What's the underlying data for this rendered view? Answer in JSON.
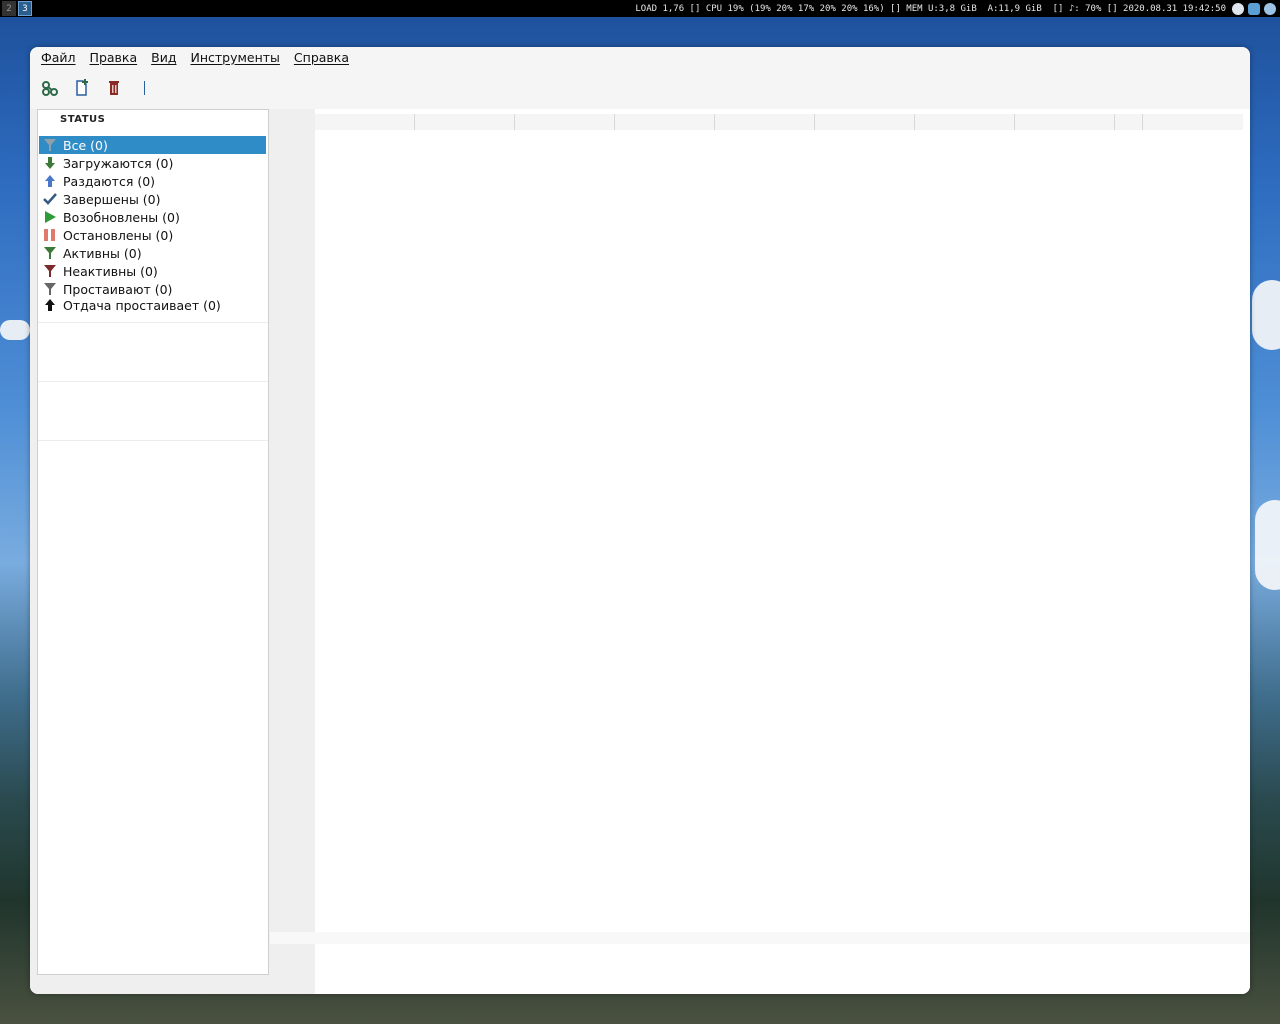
{
  "panel": {
    "workspaces": [
      "2",
      "3"
    ],
    "status": "LOAD 1,76 [] CPU 19% (19% 20% 17% 20% 20% 16%) [] MEM U:3,8 GiB  A:11,9 GiB  [] ♪: 70% [] 2020.08.31 19:42:50"
  },
  "menu": {
    "file": "Файл",
    "edit": "Правка",
    "view": "Вид",
    "tools": "Инструменты",
    "help": "Справка"
  },
  "toolbar": {
    "icons": [
      "add-torrent-link-icon",
      "add-torrent-file-icon",
      "delete-icon"
    ]
  },
  "sidebar": {
    "header": "STATUS",
    "filters": [
      {
        "label": "Все (0)",
        "icon": "filter-icon"
      },
      {
        "label": "Загружаются (0)",
        "icon": "arrow-down-icon"
      },
      {
        "label": "Раздаются (0)",
        "icon": "arrow-up-icon"
      },
      {
        "label": "Завершены (0)",
        "icon": "checkmark-icon"
      },
      {
        "label": "Возобновлены (0)",
        "icon": "play-icon"
      },
      {
        "label": "Остановлены (0)",
        "icon": "pause-icon"
      },
      {
        "label": "Активны (0)",
        "icon": "filter-active-icon"
      },
      {
        "label": "Неактивны (0)",
        "icon": "filter-inactive-icon"
      },
      {
        "label": "Простаивают (0)",
        "icon": "filter-stalled-icon"
      },
      {
        "label": "Отдача простаивает (0)",
        "icon": "upload-stalled-icon"
      }
    ]
  },
  "colors": {
    "selection": "#308cc6",
    "separator": "#2a5f9e"
  }
}
